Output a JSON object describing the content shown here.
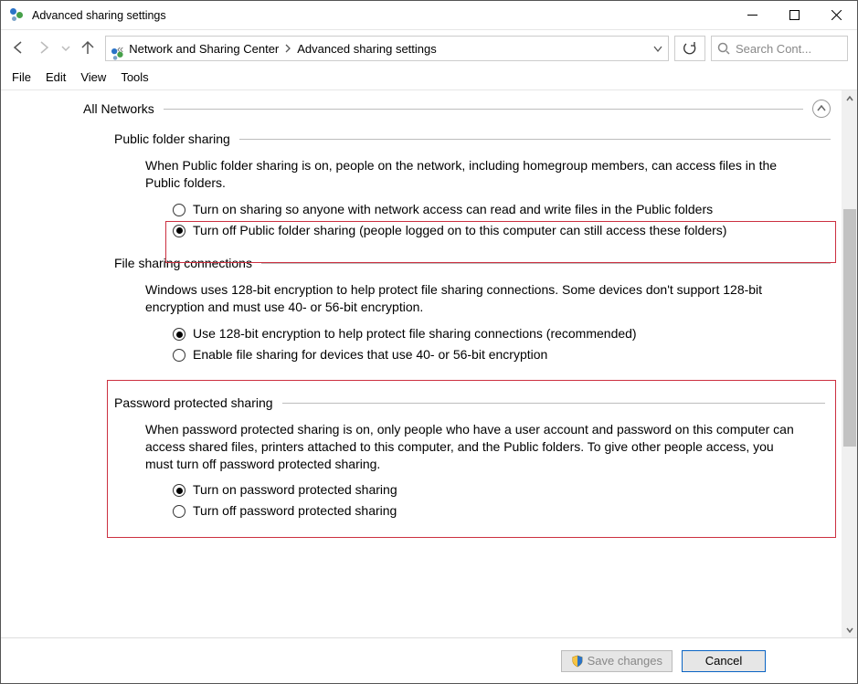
{
  "titlebar": {
    "title": "Advanced sharing settings"
  },
  "breadcrumb": {
    "item1": "Network and Sharing Center",
    "item2": "Advanced sharing settings"
  },
  "search": {
    "placeholder": "Search Cont..."
  },
  "menu": {
    "file": "File",
    "edit": "Edit",
    "view": "View",
    "tools": "Tools"
  },
  "profile": {
    "label": "All Networks"
  },
  "public_sharing": {
    "heading": "Public folder sharing",
    "desc": "When Public folder sharing is on, people on the network, including homegroup members, can access files in the Public folders.",
    "opt_on": "Turn on sharing so anyone with network access can read and write files in the Public folders",
    "opt_off": "Turn off Public folder sharing (people logged on to this computer can still access these folders)"
  },
  "file_conn": {
    "heading": "File sharing connections",
    "desc": "Windows uses 128-bit encryption to help protect file sharing connections. Some devices don't support 128-bit encryption and must use 40- or 56-bit encryption.",
    "opt_128": "Use 128-bit encryption to help protect file sharing connections (recommended)",
    "opt_4056": "Enable file sharing for devices that use 40- or 56-bit encryption"
  },
  "password": {
    "heading": "Password protected sharing",
    "desc": "When password protected sharing is on, only people who have a user account and password on this computer can access shared files, printers attached to this computer, and the Public folders. To give other people access, you must turn off password protected sharing.",
    "opt_on": "Turn on password protected sharing",
    "opt_off": "Turn off password protected sharing"
  },
  "footer": {
    "save": "Save changes",
    "cancel": "Cancel"
  }
}
